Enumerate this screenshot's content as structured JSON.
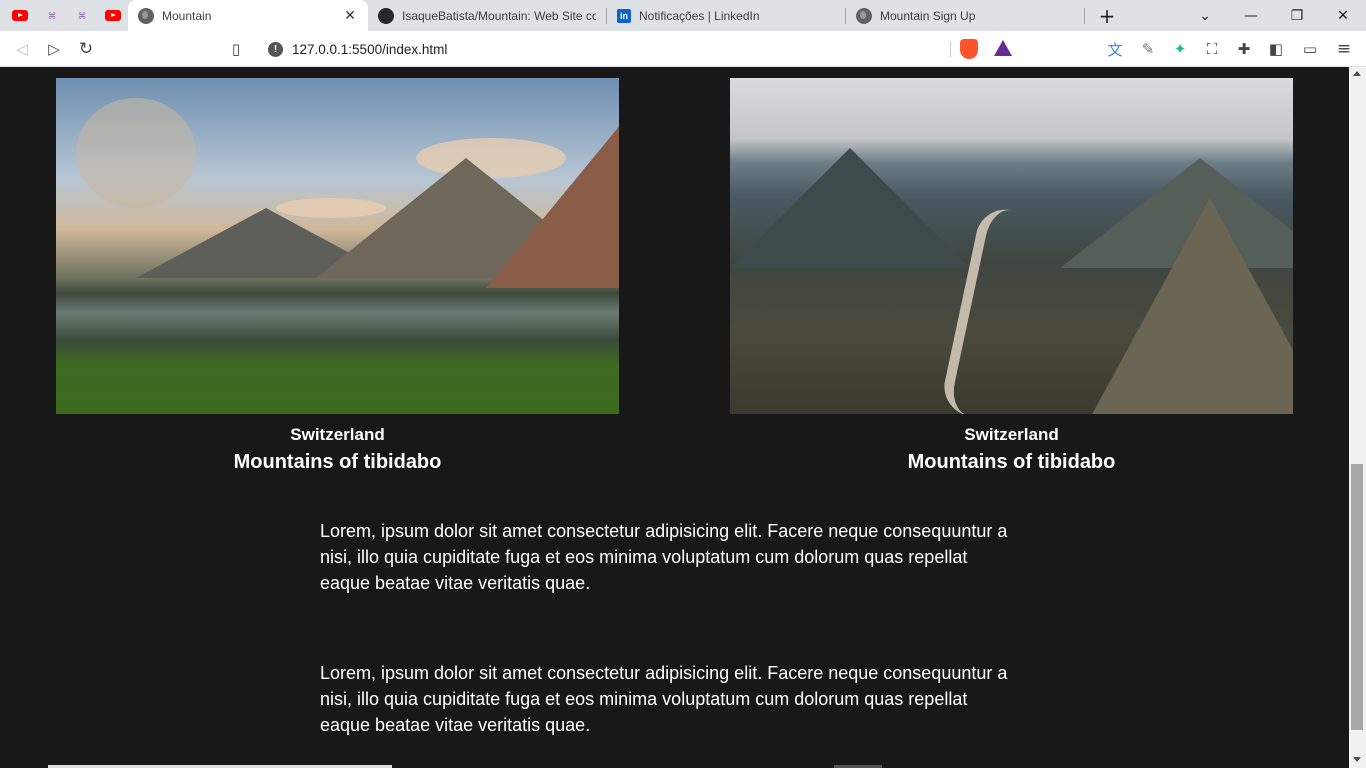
{
  "browser": {
    "tabs": [
      {
        "title": "Mountain",
        "active": true,
        "icon": "globe-icon"
      },
      {
        "title": "IsaqueBatista/Mountain: Web Site cor",
        "active": false,
        "icon": "github-icon"
      },
      {
        "title": "Notificações | LinkedIn",
        "active": false,
        "icon": "linkedin-icon"
      },
      {
        "title": "Mountain Sign Up",
        "active": false,
        "icon": "globe-icon"
      }
    ],
    "pinned_tabs": [
      "youtube-icon",
      "grid-icon",
      "grid-icon",
      "youtube-icon"
    ],
    "close_glyph": "✕",
    "new_tab_glyph": "+",
    "url": "127.0.0.1:5500/index.html",
    "info_glyph": "!",
    "linkedin_glyph": "in"
  },
  "cards": [
    {
      "country": "Switzerland",
      "place": "Mountains of tibidabo",
      "image": "mountain-lake-photo"
    },
    {
      "country": "Switzerland",
      "place": "Mountains of tibidabo",
      "image": "river-valley-photo"
    }
  ],
  "paragraphs": [
    "Lorem, ipsum dolor sit amet consectetur adipisicing elit. Facere neque consequuntur a nisi, illo quia cupiditate fuga et eos minima voluptatum cum dolorum quas repellat eaque beatae vitae veritatis quae.",
    "Lorem, ipsum dolor sit amet consectetur adipisicing elit. Facere neque consequuntur a nisi, illo quia cupiditate fuga et eos minima voluptatum cum dolorum quas repellat eaque beatae vitae veritatis quae."
  ],
  "colors": {
    "page_bg": "#181818",
    "text": "#ffffff",
    "tabbar_bg": "#dee1e6"
  }
}
